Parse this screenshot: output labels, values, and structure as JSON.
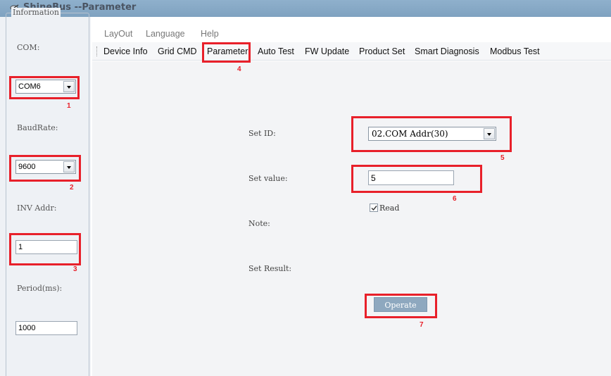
{
  "window": {
    "title": "ShineBus --Parameter",
    "icon": "satellite-dish-icon"
  },
  "sidebar": {
    "group_title": "Information",
    "com_label": "COM:",
    "com_value": "COM6",
    "baud_label": "BaudRate:",
    "baud_value": "9600",
    "inv_label": "INV Addr:",
    "inv_value": "1",
    "period_label": "Period(ms):",
    "period_value": "1000"
  },
  "menu": [
    "LayOut",
    "Language",
    "Help"
  ],
  "tabs": [
    "Device Info",
    "Grid CMD",
    "Parameter",
    "Auto Test",
    "FW Update",
    "Product Set",
    "Smart Diagnosis",
    "Modbus Test"
  ],
  "active_tab": "Parameter",
  "form": {
    "set_id_label": "Set ID:",
    "set_id_value": "02.COM Addr(30)",
    "set_value_label": "Set value:",
    "set_value": "5",
    "read_label": "Read",
    "read_checked": true,
    "note_label": "Note:",
    "result_label": "Set Result:",
    "operate_label": "Operate"
  },
  "annotations": [
    "1",
    "2",
    "3",
    "4",
    "5",
    "6",
    "7"
  ],
  "colors": {
    "annotation_red": "#e8202a",
    "titlebar": "#8fb0cc",
    "operate_button": "#8ea8bf"
  }
}
